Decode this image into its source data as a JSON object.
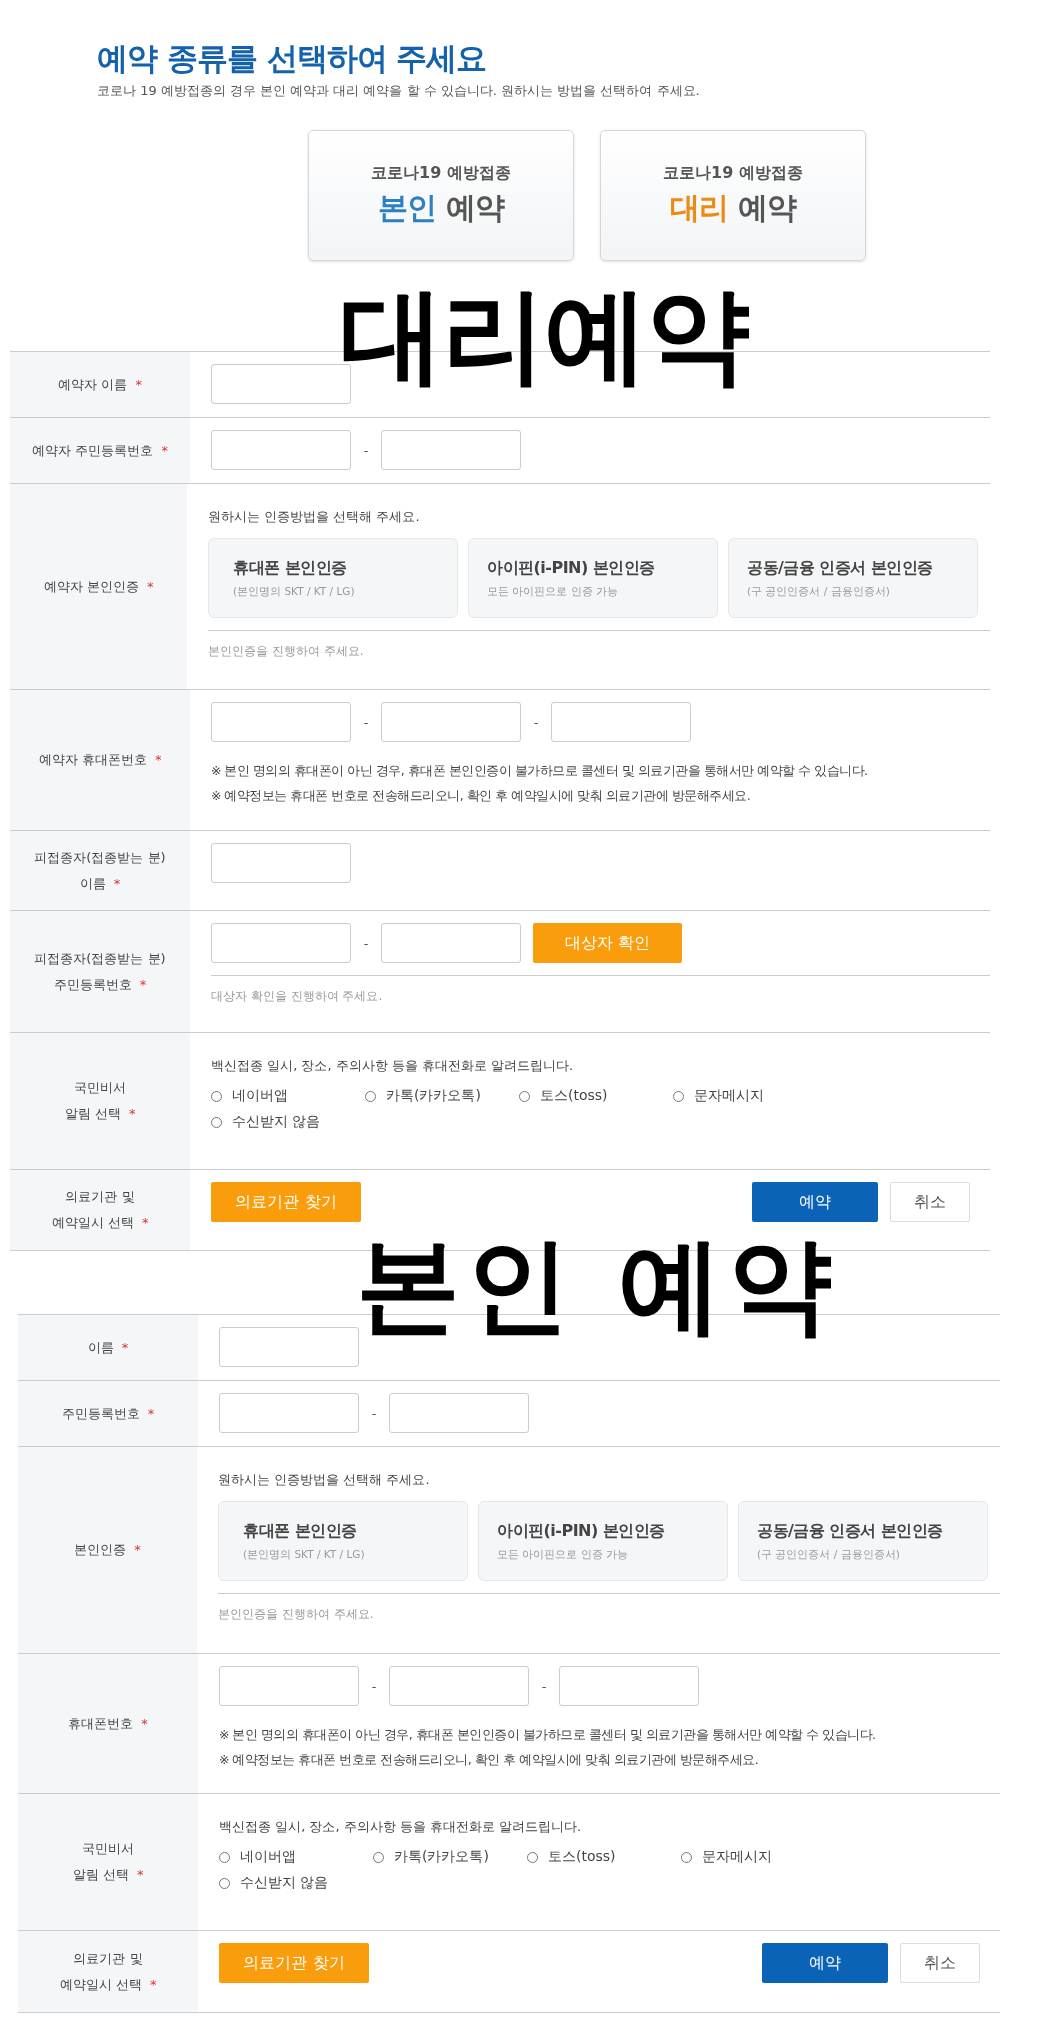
{
  "heading": {
    "title": "예약 종류를 선택하여 주세요",
    "subtitle": "코로나 19 예방접종의 경우 본인 예약과 대리 예약을 할 수 있습니다. 원하시는 방법을 선택하여 주세요."
  },
  "choices": [
    {
      "line1": "코로나19 예방접종",
      "accent": "본인",
      "rest": "예약",
      "color": "#2f7fc4"
    },
    {
      "line1": "코로나19 예방접종",
      "accent": "대리",
      "rest": "예약",
      "color": "#ee8a12"
    }
  ],
  "sections": [
    {
      "overlay": "대리예약",
      "rows": [
        {
          "kind": "inputs",
          "label": [
            "예약자 이름"
          ],
          "mark": "*"
        },
        {
          "kind": "inputs",
          "label": [
            "예약자 주민등록번호"
          ],
          "mark": "*",
          "separators": [
            "-"
          ]
        },
        {
          "kind": "auth",
          "label": [
            "예약자 본인인증"
          ],
          "mark": "*",
          "prompt": "원하시는 인증방법을 선택해 주세요.",
          "options": [
            {
              "title": "휴대폰 본인인증",
              "sub": "(본인명의 SKT / KT / LG)"
            },
            {
              "title": "아이핀(i-PIN) 본인인증",
              "sub": "모든 아이핀으로 인증 가능"
            },
            {
              "title": "공동/금융 인증서 본인인증",
              "sub": "(구 공인인증서 / 금융인증서)"
            }
          ],
          "hint": "본인인증을 진행하여 주세요."
        },
        {
          "kind": "inputs",
          "label": [
            "예약자 휴대폰번호"
          ],
          "mark": "*",
          "separators": [
            "-",
            "-"
          ],
          "notes": [
            "※ 본인 명의의 휴대폰이 아닌 경우, 휴대폰 본인인증이 불가하므로 콜센터 및 의료기관을 통해서만 예약할 수 있습니다.",
            "※ 예약정보는 휴대폰 번호로 전송해드리오니, 확인 후 예약일시에 맞춰 의료기관에 방문해주세요."
          ]
        },
        {
          "kind": "inputs",
          "label": [
            "피접종자(접종받는 분)",
            "이름"
          ],
          "mark": "*"
        },
        {
          "kind": "inputs",
          "label": [
            "피접종자(접종받는 분)",
            "주민등록번호"
          ],
          "mark": "*",
          "separators": [
            "-"
          ],
          "button": "대상자 확인",
          "hint": "대상자 확인을 진행하여 주세요."
        },
        {
          "kind": "notify",
          "label": [
            "국민비서",
            "알림 선택"
          ],
          "mark": "*",
          "prompt": "백신접종 일시, 장소, 주의사항 등을 휴대전화로 알려드립니다.",
          "options": [
            {
              "label": "네이버앱",
              "selected": false
            },
            {
              "label": "카톡(카카오톡)",
              "selected": false
            },
            {
              "label": "토스(toss)",
              "selected": false
            },
            {
              "label": "문자메시지",
              "selected": false
            },
            {
              "label": "수신받지 않음",
              "selected": false
            }
          ]
        },
        {
          "kind": "submit",
          "label": [
            "의료기관 및",
            "예약일시 선택"
          ],
          "mark": "*",
          "find": "의료기관 찾기",
          "reserve": "예약",
          "cancel": "취소"
        }
      ]
    },
    {
      "overlay": "본인 예약",
      "rows": [
        {
          "kind": "inputs",
          "label": [
            "이름"
          ],
          "mark": "*"
        },
        {
          "kind": "inputs",
          "label": [
            "주민등록번호"
          ],
          "mark": "*",
          "separators": [
            "-"
          ]
        },
        {
          "kind": "auth",
          "label": [
            "본인인증"
          ],
          "mark": "*",
          "prompt": "원하시는 인증방법을 선택해 주세요.",
          "options": [
            {
              "title": "휴대폰 본인인증",
              "sub": "(본인명의 SKT / KT / LG)"
            },
            {
              "title": "아이핀(i-PIN) 본인인증",
              "sub": "모든 아이핀으로 인증 가능"
            },
            {
              "title": "공동/금융 인증서 본인인증",
              "sub": "(구 공인인증서 / 금융인증서)"
            }
          ],
          "hint": "본인인증을 진행하여 주세요."
        },
        {
          "kind": "inputs",
          "label": [
            "휴대폰번호"
          ],
          "mark": "*",
          "separators": [
            "-",
            "-"
          ],
          "notes": [
            "※ 본인 명의의 휴대폰이 아닌 경우, 휴대폰 본인인증이 불가하므로 콜센터 및 의료기관을 통해서만 예약할 수 있습니다.",
            "※ 예약정보는 휴대폰 번호로 전송해드리오니, 확인 후 예약일시에 맞춰 의료기관에 방문해주세요."
          ]
        },
        {
          "kind": "notify",
          "label": [
            "국민비서",
            "알림 선택"
          ],
          "mark": "*",
          "prompt": "백신접종 일시, 장소, 주의사항 등을 휴대전화로 알려드립니다.",
          "options": [
            {
              "label": "네이버앱",
              "selected": false
            },
            {
              "label": "카톡(카카오톡)",
              "selected": false
            },
            {
              "label": "토스(toss)",
              "selected": false
            },
            {
              "label": "문자메시지",
              "selected": false
            },
            {
              "label": "수신받지 않음",
              "selected": false
            }
          ]
        },
        {
          "kind": "submit",
          "label": [
            "의료기관 및",
            "예약일시 선택"
          ],
          "mark": "*",
          "find": "의료기관 찾기",
          "reserve": "예약",
          "cancel": "취소"
        }
      ]
    }
  ]
}
